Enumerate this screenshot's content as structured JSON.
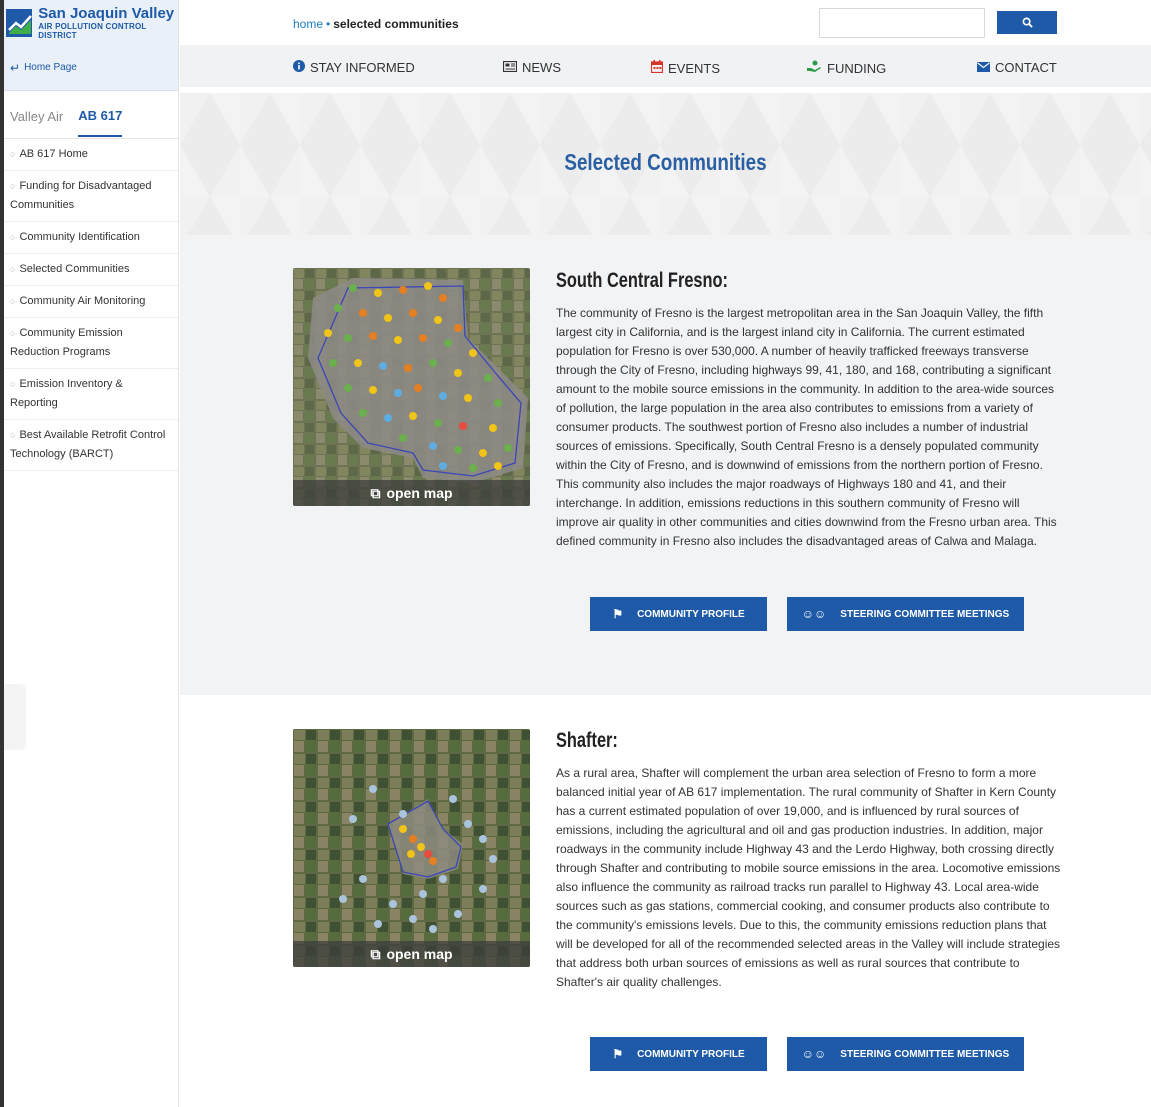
{
  "logo": {
    "name": "San Joaquin Valley",
    "subtitle": "AIR POLLUTION CONTROL DISTRICT"
  },
  "sidebar": {
    "home_link": "Home Page",
    "tabs": [
      {
        "label": "Valley Air"
      },
      {
        "label": "AB 617"
      }
    ],
    "items": [
      {
        "label": "AB 617 Home"
      },
      {
        "label": "Funding for Disadvantaged Communities"
      },
      {
        "label": "Community Identification"
      },
      {
        "label": "Selected Communities"
      },
      {
        "label": "Community Air Monitoring"
      },
      {
        "label": "Community Emission Reduction Programs"
      },
      {
        "label": "Emission Inventory & Reporting"
      },
      {
        "label": "Best Available Retrofit Control Technology (BARCT)"
      }
    ]
  },
  "breadcrumb": {
    "home": "home",
    "separator": "•",
    "current": "selected communities"
  },
  "search": {
    "placeholder": ""
  },
  "nav": [
    {
      "label": "STAY INFORMED",
      "icon": "info-icon"
    },
    {
      "label": "NEWS",
      "icon": "newspaper-icon"
    },
    {
      "label": "EVENTS",
      "icon": "calendar-icon"
    },
    {
      "label": "FUNDING",
      "icon": "funding-icon"
    },
    {
      "label": "CONTACT",
      "icon": "envelope-icon"
    }
  ],
  "hero": {
    "title": "Selected Communities"
  },
  "communities": [
    {
      "title": "South Central Fresno:",
      "map_label": "open map",
      "body": "The community of Fresno is the largest metropolitan area in the San Joaquin Valley, the fifth largest city in California, and is the largest inland city in California. The current estimated population for Fresno is over 530,000. A number of heavily trafficked freeways transverse through the City of Fresno, including highways 99, 41, 180, and 168, contributing a significant amount to the mobile source emissions in the community. In addition to the area-wide sources of pollution, the large population in the area also contributes to emissions from a variety of consumer products. The southwest portion of Fresno also includes a number of industrial sources of emissions. Specifically, South Central Fresno is a densely populated community within the City of Fresno, and is downwind of emissions from the northern portion of Fresno. This community also includes the major roadways of Highways 180 and 41, and their interchange. In addition, emissions reductions in this southern community of Fresno will improve air quality in other communities and cities downwind from the Fresno urban area. This defined community in Fresno also includes the disadvantaged areas of Calwa and Malaga.",
      "buttons": {
        "profile": "COMMUNITY PROFILE",
        "meetings": "STEERING COMMITTEE MEETINGS"
      }
    },
    {
      "title": "Shafter:",
      "map_label": "open map",
      "body": "As a rural area, Shafter will complement the urban area selection of Fresno to form a more balanced initial year of AB 617 implementation. The rural community of Shafter in Kern County has a current estimated population of over 19,000, and is influenced by rural sources of emissions, including the agricultural and oil and gas production industries. In addition, major roadways in the community include Highway 43 and the Lerdo Highway, both crossing directly through Shafter and contributing to mobile source emissions in the area. Locomotive emissions also influence the community as railroad tracks run parallel to Highway 43. Local area-wide sources such as gas stations, commercial cooking, and consumer products also contribute to the community's emissions levels. Due to this, the community emissions reduction plans that will be developed for all of the recommended selected areas in the Valley will include strategies that address both urban sources of emissions as well as rural sources that contribute to Shafter's air quality challenges.",
      "buttons": {
        "profile": "COMMUNITY PROFILE",
        "meetings": "STEERING COMMITTEE MEETINGS"
      }
    }
  ],
  "colors": {
    "brand": "#1e5aa8",
    "link": "#1e7ec8",
    "events_icon": "#d9342b",
    "funding_icon": "#2e9b4a"
  }
}
